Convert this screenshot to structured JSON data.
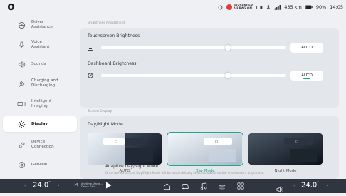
{
  "status": {
    "airbag_line1": "PASSENGER",
    "airbag_line2": "AIRBAG ON",
    "range": "435 km",
    "battery": "90%",
    "time": "14:05"
  },
  "sidebar": {
    "items": [
      {
        "label": "Driver\nAssistance",
        "icon": "steering-wheel-icon"
      },
      {
        "label": "Voice\nAssistant",
        "icon": "microphone-icon"
      },
      {
        "label": "Sounds",
        "icon": "speaker-icon"
      },
      {
        "label": "Charging and\nDischarging",
        "icon": "charging-plug-icon"
      },
      {
        "label": "Intelligent\nImaging",
        "icon": "camera-icon"
      },
      {
        "label": "Display",
        "icon": "sun-icon"
      },
      {
        "label": "Device\nConnection",
        "icon": "link-icon"
      },
      {
        "label": "General",
        "icon": "settings-icon"
      }
    ],
    "active_index": 5
  },
  "brightness": {
    "section_title": "Brightness Adjustment",
    "touchscreen": {
      "label": "Touchscreen Brightness",
      "value": 0.68,
      "auto_label": "AUTO"
    },
    "dashboard": {
      "label": "Dashboard Brightness",
      "value": 0.68,
      "auto_label": "AUTO"
    }
  },
  "screen_display": {
    "section_title": "Screen Display",
    "daynight_title": "Day/Night Mode",
    "modes": [
      {
        "label": "AUTO"
      },
      {
        "label": "Day Mode"
      },
      {
        "label": "Night Mode"
      }
    ],
    "selected_mode_index": 1,
    "adaptive": {
      "title": "Adaptive Day/Night Mode",
      "description": "Once turned on, the Day/Night Mode will be automatically switched based on the environment brightness.",
      "enabled": false
    }
  },
  "dock": {
    "left_temp": "24.0",
    "right_temp": "24.0",
    "degree": "°",
    "media_line1": "Anytime, Anyw...",
    "media_line2": "Demo Sdis"
  },
  "colors": {
    "accent": "#1fa98a",
    "airbag": "#e23b3b",
    "dock": "#2f3640"
  }
}
